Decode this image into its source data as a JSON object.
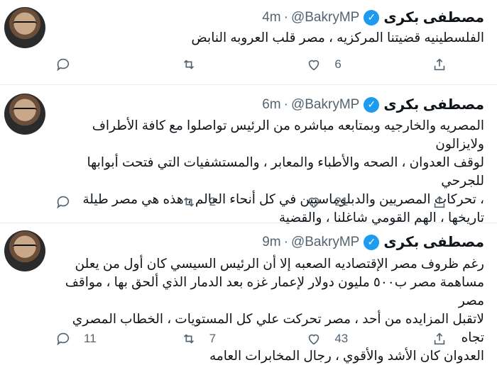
{
  "tweets": [
    {
      "name": "مصطفى بكرى",
      "handle": "@BakryMP",
      "time": "4m",
      "lines": [
        "الفلسطينيه قضيتنا المركزيه ، مصر قلب العروبه النابض"
      ],
      "reply_count": "",
      "retweet_count": "",
      "like_count": "6"
    },
    {
      "name": "مصطفى بكرى",
      "handle": "@BakryMP",
      "time": "6m",
      "lines": [
        "المصريه والخارجيه وبمتابعه مباشره من الرئيس تواصلوا مع كافة الأطراف ولايزالون",
        "لوقف العدوان ، الصحه والأطباء والمعابر ، والمستشفيات التي فتحت أبوابها للجرحي",
        "، تحركات المصريين والدبلوماسيين في كل أنحاء العالم ، هذه هي مصر طيلة",
        "تاريخها ، الهم القومي شاغلنا ، والقضية"
      ],
      "reply_count": "",
      "retweet_count": "2",
      "like_count": "21"
    },
    {
      "name": "مصطفى بكرى",
      "handle": "@BakryMP",
      "time": "9m",
      "lines": [
        "رغم ظروف مصر الإقتصاديه الصعبه إلا أن الرئيس السيسي كان أول من يعلن",
        "مساهمة مصر ب٥٠٠ مليون دولار لإعمار غزه بعد الدمار الذي ألحق بها ، مواقف مصر",
        "لاتقبل المزايده من أحد ، مصر تحركت علي كل المستويات ، الخطاب المصري تجاه",
        "العدوان كان الأشد والأقوي ، رجال المخابرات العامه"
      ],
      "reply_count": "11",
      "retweet_count": "7",
      "like_count": "43"
    }
  ],
  "icons": {
    "reply": "reply-icon",
    "retweet": "retweet-icon",
    "like": "like-icon",
    "share": "share-icon",
    "verified": "verified-badge-icon"
  },
  "colors": {
    "accent": "#1d9bf0",
    "muted": "#536471",
    "divider": "#e6ecf0"
  }
}
